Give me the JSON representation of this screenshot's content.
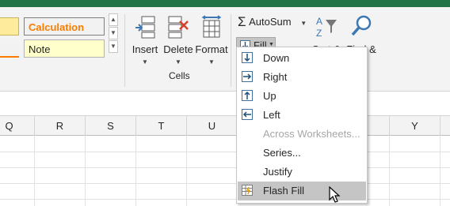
{
  "styles": {
    "calculation_label": "Calculation",
    "note_label": "Note"
  },
  "cells_group": {
    "insert_label": "Insert",
    "delete_label": "Delete",
    "format_label": "Format",
    "group_label": "Cells"
  },
  "editing": {
    "autosum_label": "AutoSum",
    "fill_label": "Fill",
    "sort_label": "Sort &",
    "find_label": "Find &"
  },
  "fill_menu": [
    {
      "label": "Down",
      "icon": "fill-down-icon",
      "disabled": false
    },
    {
      "label": "Right",
      "icon": "fill-right-icon",
      "disabled": false
    },
    {
      "label": "Up",
      "icon": "fill-up-icon",
      "disabled": false
    },
    {
      "label": "Left",
      "icon": "fill-left-icon",
      "disabled": false
    },
    {
      "label": "Across Worksheets...",
      "icon": "",
      "disabled": true
    },
    {
      "label": "Series...",
      "icon": "",
      "disabled": false
    },
    {
      "label": "Justify",
      "icon": "",
      "disabled": false
    },
    {
      "label": "Flash Fill",
      "icon": "flash-fill-icon",
      "disabled": false,
      "highlighted": true
    }
  ],
  "columns": [
    "Q",
    "R",
    "S",
    "T",
    "U",
    "Y"
  ],
  "colors": {
    "ribbon_accent": "#217346",
    "calculation_text": "#fa7d00",
    "note_fill": "#ffffcc",
    "menu_highlight": "#c5c5c5"
  }
}
